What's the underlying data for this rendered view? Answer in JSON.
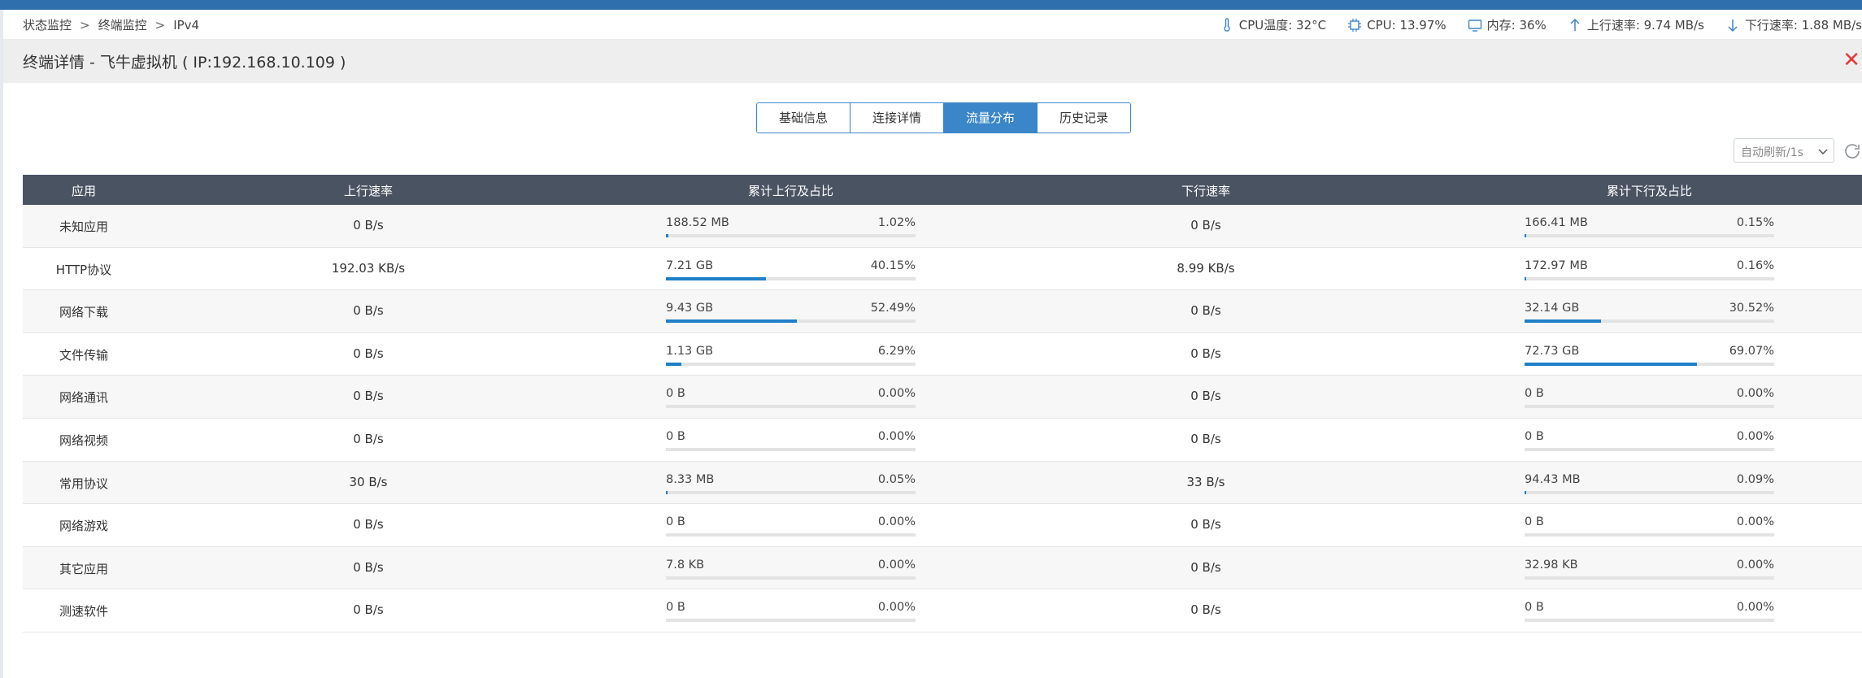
{
  "breadcrumb": [
    "状态监控",
    "终端监控",
    "IPv4"
  ],
  "breadcrumb_sep": ">",
  "status": {
    "cpu_temp": "CPU温度: 32°C",
    "cpu": "CPU: 13.97%",
    "mem": "内存: 36%",
    "up": "上行速率: 9.74 MB/s",
    "down": "下行速率: 1.88 MB/s"
  },
  "title": "终端详情 - 飞牛虚拟机 ( IP:192.168.10.109 )",
  "close": "✕",
  "tabs": [
    "基础信息",
    "连接详情",
    "流量分布",
    "历史记录"
  ],
  "active_tab": 2,
  "refresh": {
    "label": "自动刷新/1s"
  },
  "table": {
    "headers": [
      "应用",
      "上行速率",
      "累计上行及占比",
      "下行速率",
      "累计下行及占比"
    ],
    "rows": [
      {
        "app": "未知应用",
        "up": "0 B/s",
        "up_total": "188.52 MB",
        "up_pct": "1.02%",
        "up_frac": 0.0102,
        "down": "0 B/s",
        "down_total": "166.41 MB",
        "down_pct": "0.15%",
        "down_frac": 0.0015
      },
      {
        "app": "HTTP协议",
        "up": "192.03 KB/s",
        "up_total": "7.21 GB",
        "up_pct": "40.15%",
        "up_frac": 0.4015,
        "down": "8.99 KB/s",
        "down_total": "172.97 MB",
        "down_pct": "0.16%",
        "down_frac": 0.0016
      },
      {
        "app": "网络下载",
        "up": "0 B/s",
        "up_total": "9.43 GB",
        "up_pct": "52.49%",
        "up_frac": 0.5249,
        "down": "0 B/s",
        "down_total": "32.14 GB",
        "down_pct": "30.52%",
        "down_frac": 0.3052
      },
      {
        "app": "文件传输",
        "up": "0 B/s",
        "up_total": "1.13 GB",
        "up_pct": "6.29%",
        "up_frac": 0.0629,
        "down": "0 B/s",
        "down_total": "72.73 GB",
        "down_pct": "69.07%",
        "down_frac": 0.6907
      },
      {
        "app": "网络通讯",
        "up": "0 B/s",
        "up_total": "0 B",
        "up_pct": "0.00%",
        "up_frac": 0,
        "down": "0 B/s",
        "down_total": "0 B",
        "down_pct": "0.00%",
        "down_frac": 0
      },
      {
        "app": "网络视频",
        "up": "0 B/s",
        "up_total": "0 B",
        "up_pct": "0.00%",
        "up_frac": 0,
        "down": "0 B/s",
        "down_total": "0 B",
        "down_pct": "0.00%",
        "down_frac": 0
      },
      {
        "app": "常用协议",
        "up": "30 B/s",
        "up_total": "8.33 MB",
        "up_pct": "0.05%",
        "up_frac": 0.0005,
        "down": "33 B/s",
        "down_total": "94.43 MB",
        "down_pct": "0.09%",
        "down_frac": 0.0009
      },
      {
        "app": "网络游戏",
        "up": "0 B/s",
        "up_total": "0 B",
        "up_pct": "0.00%",
        "up_frac": 0,
        "down": "0 B/s",
        "down_total": "0 B",
        "down_pct": "0.00%",
        "down_frac": 0
      },
      {
        "app": "其它应用",
        "up": "0 B/s",
        "up_total": "7.8 KB",
        "up_pct": "0.00%",
        "up_frac": 0,
        "down": "0 B/s",
        "down_total": "32.98 KB",
        "down_pct": "0.00%",
        "down_frac": 0
      },
      {
        "app": "测速软件",
        "up": "0 B/s",
        "up_total": "0 B",
        "up_pct": "0.00%",
        "up_frac": 0,
        "down": "0 B/s",
        "down_total": "0 B",
        "down_pct": "0.00%",
        "down_frac": 0
      }
    ]
  },
  "colors": {
    "accent": "#3a86c8",
    "bar_fill": "#1e7fc8",
    "header_bg": "#4a5362",
    "close": "#e03b3b",
    "top_strip": "#2f6fad"
  },
  "icons": {
    "cpu_temp": "thermometer-icon",
    "cpu": "chip-icon",
    "mem": "monitor-icon",
    "up": "arrow-up-icon",
    "down": "arrow-down-icon",
    "refresh": "refresh-icon",
    "dropdown": "chevron-down-icon",
    "close": "close-icon"
  }
}
